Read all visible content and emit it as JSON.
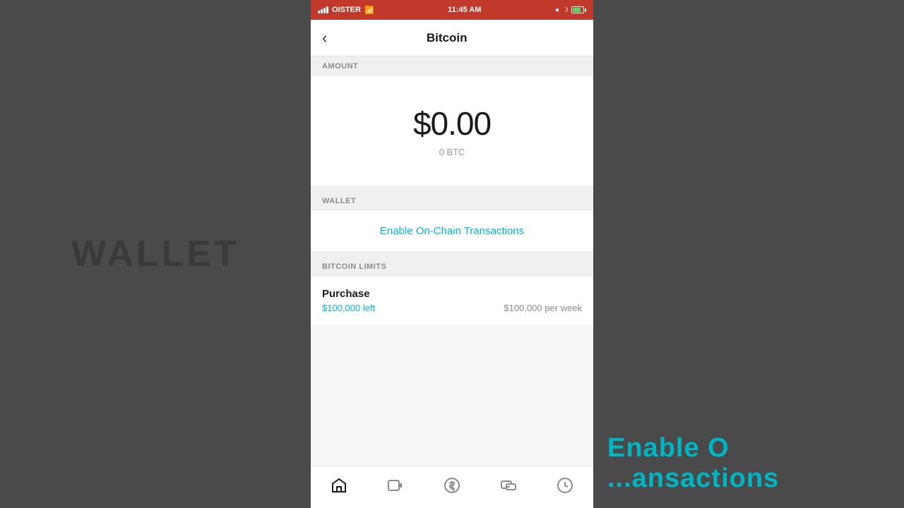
{
  "status_bar": {
    "carrier": "OISTER",
    "time": "11:45 AM",
    "signal_bars": 4,
    "wifi": true,
    "battery_percent": 80
  },
  "nav": {
    "back_label": "‹",
    "title": "Bitcoin"
  },
  "amount_section": {
    "header": "AMOUNT",
    "usd_value": "$0.00",
    "btc_value": "0 BTC"
  },
  "wallet_section": {
    "header": "WALLET",
    "enable_link": "Enable On-Chain Transactions"
  },
  "limits_section": {
    "header": "BITCOIN LIMITS",
    "purchase_label": "Purchase",
    "purchase_left": "$100,000 left",
    "purchase_weekly": "$100,000 per week"
  },
  "tab_bar": {
    "tabs": [
      {
        "name": "home",
        "icon": "home",
        "active": true
      },
      {
        "name": "video",
        "icon": "video",
        "active": false
      },
      {
        "name": "dollar",
        "icon": "dollar",
        "active": false
      },
      {
        "name": "card",
        "icon": "card",
        "active": false
      },
      {
        "name": "clock",
        "icon": "clock",
        "active": false
      }
    ]
  },
  "bg_left_text": "WALLET",
  "bg_right_text": "Enable O...    ...ansactions"
}
